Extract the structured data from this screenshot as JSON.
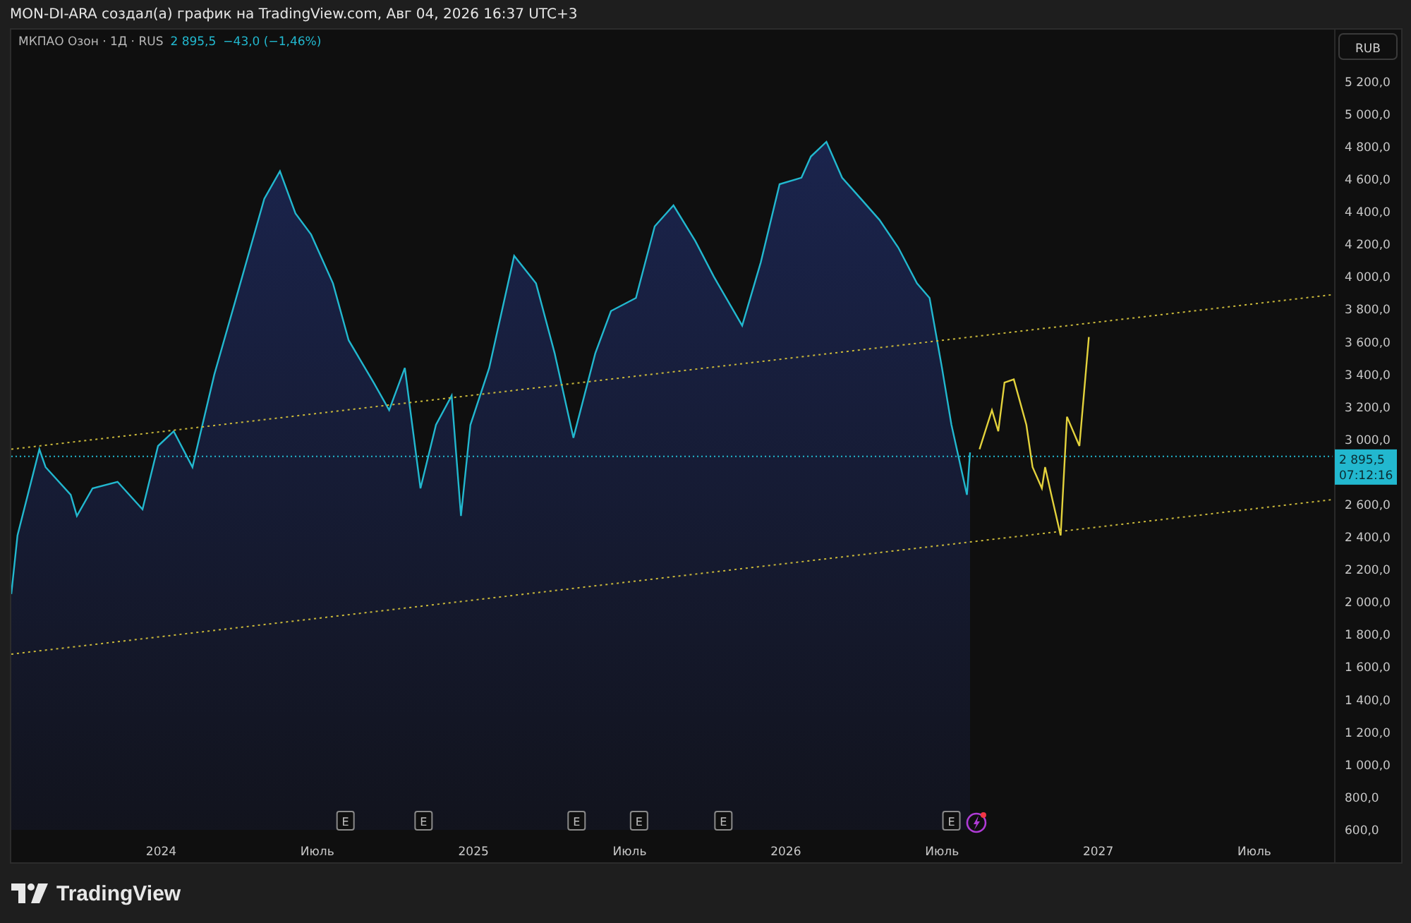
{
  "header": {
    "text": "MON-DI-ARA создал(а) график на TradingView.com, Авг 04, 2026 16:37 UTC+3"
  },
  "legend": {
    "symbol": "МКПАО Озон · 1Д · RUS",
    "price": "2 895,5",
    "change": "−43,0 (−1,46%)"
  },
  "currency_button": {
    "label": "RUB"
  },
  "price_badge": {
    "price": "2 895,5",
    "countdown": "07:12:16"
  },
  "chart_data": {
    "type": "area",
    "xlim": [
      2023.52,
      2027.97
    ],
    "ylim": [
      400,
      5520
    ],
    "xticks": [
      {
        "value": 2024,
        "label": "2024"
      },
      {
        "value": 2024.5,
        "label": "Июль"
      },
      {
        "value": 2025,
        "label": "2025"
      },
      {
        "value": 2025.5,
        "label": "Июль"
      },
      {
        "value": 2026,
        "label": "2026"
      },
      {
        "value": 2026.5,
        "label": "Июль"
      },
      {
        "value": 2027,
        "label": "2027"
      },
      {
        "value": 2027.5,
        "label": "Июль"
      }
    ],
    "yticks": [
      {
        "value": 600,
        "label": "600,0"
      },
      {
        "value": 800,
        "label": "800,0"
      },
      {
        "value": 1000,
        "label": "1 000,0"
      },
      {
        "value": 1200,
        "label": "1 200,0"
      },
      {
        "value": 1400,
        "label": "1 400,0"
      },
      {
        "value": 1600,
        "label": "1 600,0"
      },
      {
        "value": 1800,
        "label": "1 800,0"
      },
      {
        "value": 2000,
        "label": "2 000,0"
      },
      {
        "value": 2200,
        "label": "2 200,0"
      },
      {
        "value": 2400,
        "label": "2 400,0"
      },
      {
        "value": 2600,
        "label": "2 600,0"
      },
      {
        "value": 3000,
        "label": "3 000,0"
      },
      {
        "value": 3200,
        "label": "3 200,0"
      },
      {
        "value": 3400,
        "label": "3 400,0"
      },
      {
        "value": 3600,
        "label": "3 600,0"
      },
      {
        "value": 3800,
        "label": "3 800,0"
      },
      {
        "value": 4000,
        "label": "4 000,0"
      },
      {
        "value": 4200,
        "label": "4 200,0"
      },
      {
        "value": 4400,
        "label": "4 400,0"
      },
      {
        "value": 4600,
        "label": "4 600,0"
      },
      {
        "value": 4800,
        "label": "4 800,0"
      },
      {
        "value": 5000,
        "label": "5 000,0"
      },
      {
        "value": 5200,
        "label": "5 200,0"
      }
    ],
    "x": [
      2023.52,
      2023.54,
      2023.61,
      2023.63,
      2023.71,
      2023.73,
      2023.78,
      2023.86,
      2023.94,
      2023.99,
      2024.04,
      2024.1,
      2024.17,
      2024.24,
      2024.33,
      2024.38,
      2024.43,
      2024.48,
      2024.55,
      2024.6,
      2024.68,
      2024.73,
      2024.78,
      2024.83,
      2024.88,
      2024.93,
      2024.96,
      2024.99,
      2025.05,
      2025.13,
      2025.2,
      2025.26,
      2025.32,
      2025.39,
      2025.44,
      2025.52,
      2025.58,
      2025.64,
      2025.71,
      2025.77,
      2025.86,
      2025.92,
      2025.98,
      2026.05,
      2026.08,
      2026.13,
      2026.18,
      2026.24,
      2026.3,
      2026.36,
      2026.42,
      2026.46,
      2026.5,
      2026.53,
      2026.58,
      2026.59,
      2026.62,
      2026.66,
      2026.68,
      2026.7,
      2026.73,
      2026.77,
      2026.79,
      2026.82,
      2026.83,
      2026.85,
      2026.88,
      2026.9,
      2026.94,
      2026.97,
      2027.75
    ],
    "series": [
      {
        "color": "#22b8cf",
        "values": [
          2050,
          2410,
          2940,
          2830,
          2660,
          2530,
          2700,
          2740,
          2570,
          2960,
          3050,
          2830,
          3400,
          3870,
          4480,
          4650,
          4390,
          4260,
          3960,
          3610,
          3350,
          3180,
          3440,
          2700,
          3090,
          3270,
          2530,
          3090,
          3440,
          4130,
          3960,
          3530,
          3010,
          3530,
          3790,
          3870,
          4310,
          4440,
          4220,
          4000,
          3700,
          4090,
          4570,
          4610,
          4740,
          4830,
          4610,
          4480,
          4350,
          4180,
          3960,
          3870,
          3440,
          3090,
          2660,
          2920,
          null,
          null,
          null,
          null,
          null,
          null,
          null,
          null,
          null,
          null,
          null,
          null,
          null,
          null,
          null
        ]
      },
      {
        "color": "#e3d23c",
        "type": "line",
        "values": [
          null,
          null,
          null,
          null,
          null,
          null,
          null,
          null,
          null,
          null,
          null,
          null,
          null,
          null,
          null,
          null,
          null,
          null,
          null,
          null,
          null,
          null,
          null,
          null,
          null,
          null,
          null,
          null,
          null,
          null,
          null,
          null,
          null,
          null,
          null,
          null,
          null,
          null,
          null,
          null,
          null,
          null,
          null,
          null,
          null,
          null,
          null,
          null,
          null,
          null,
          null,
          null,
          null,
          null,
          null,
          null,
          2940,
          3180,
          3050,
          3350,
          3370,
          3090,
          2830,
          2700,
          2830,
          2660,
          2410,
          3140,
          2960,
          3630,
          null
        ]
      },
      {
        "color": "#c9b83a",
        "type": "line",
        "line_style": "dotted",
        "values": [
          2940,
          null,
          null,
          null,
          null,
          null,
          null,
          null,
          null,
          null,
          null,
          null,
          null,
          null,
          null,
          null,
          null,
          null,
          null,
          null,
          null,
          null,
          null,
          null,
          null,
          null,
          null,
          null,
          null,
          null,
          null,
          null,
          null,
          null,
          null,
          null,
          null,
          null,
          null,
          null,
          null,
          null,
          null,
          null,
          null,
          null,
          null,
          null,
          null,
          null,
          null,
          null,
          null,
          null,
          null,
          null,
          null,
          null,
          null,
          null,
          null,
          null,
          null,
          null,
          null,
          null,
          null,
          null,
          null,
          null,
          3890
        ]
      },
      {
        "color": "#c9b83a",
        "type": "line",
        "line_style": "dotted",
        "values": [
          1680,
          null,
          null,
          null,
          null,
          null,
          null,
          null,
          null,
          null,
          null,
          null,
          null,
          null,
          null,
          null,
          null,
          null,
          null,
          null,
          null,
          null,
          null,
          null,
          null,
          null,
          null,
          null,
          null,
          null,
          null,
          null,
          null,
          null,
          null,
          null,
          null,
          null,
          null,
          null,
          null,
          null,
          null,
          null,
          null,
          null,
          null,
          null,
          null,
          null,
          null,
          null,
          null,
          null,
          null,
          null,
          null,
          null,
          null,
          null,
          null,
          null,
          null,
          null,
          null,
          null,
          null,
          null,
          null,
          null,
          2630
        ]
      },
      {
        "color": "#22b8cf",
        "type": "line",
        "line_style": "fine-dotted",
        "values": [
          2895.5,
          null,
          null,
          null,
          null,
          null,
          null,
          null,
          null,
          null,
          null,
          null,
          null,
          null,
          null,
          null,
          null,
          null,
          null,
          null,
          null,
          null,
          null,
          null,
          null,
          null,
          null,
          null,
          null,
          null,
          null,
          null,
          null,
          null,
          null,
          null,
          null,
          null,
          null,
          null,
          null,
          null,
          null,
          null,
          null,
          null,
          null,
          null,
          null,
          null,
          null,
          null,
          null,
          null,
          null,
          null,
          null,
          null,
          null,
          null,
          null,
          null,
          null,
          null,
          null,
          null,
          null,
          null,
          null,
          null,
          2895.5
        ]
      }
    ]
  },
  "events": [
    {
      "kind": "earnings",
      "label": "E"
    },
    {
      "kind": "earnings",
      "label": "E"
    },
    {
      "kind": "earnings",
      "label": "E"
    },
    {
      "kind": "earnings",
      "label": "E"
    },
    {
      "kind": "earnings",
      "label": "E"
    },
    {
      "kind": "earnings",
      "label": "E"
    },
    {
      "kind": "dividend"
    }
  ],
  "footer": {
    "brand": "TradingView"
  }
}
